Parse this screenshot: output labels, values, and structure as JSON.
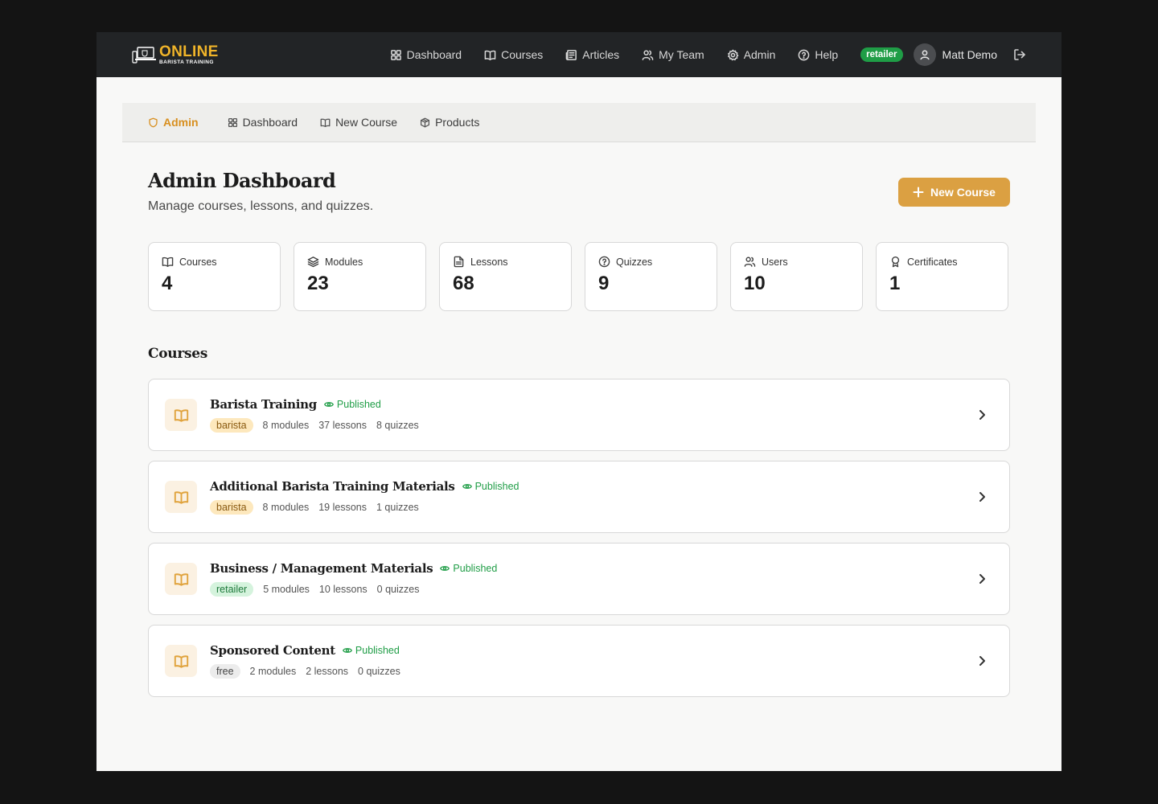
{
  "brand": {
    "main": "ONLINE",
    "sub": "BARISTA TRAINING"
  },
  "topnav": {
    "items": [
      {
        "label": "Dashboard",
        "icon": "grid-icon"
      },
      {
        "label": "Courses",
        "icon": "book-icon"
      },
      {
        "label": "Articles",
        "icon": "newspaper-icon"
      },
      {
        "label": "My Team",
        "icon": "users-icon"
      },
      {
        "label": "Admin",
        "icon": "gear-icon"
      },
      {
        "label": "Help",
        "icon": "help-circle-icon"
      }
    ],
    "role_badge": "retailer",
    "user_name": "Matt Demo"
  },
  "subnav": {
    "items": [
      {
        "label": "Admin",
        "icon": "shield-icon",
        "active": true
      },
      {
        "label": "Dashboard",
        "icon": "grid-icon"
      },
      {
        "label": "New Course",
        "icon": "book-icon"
      },
      {
        "label": "Products",
        "icon": "box-icon"
      }
    ]
  },
  "page": {
    "title": "Admin Dashboard",
    "subtitle": "Manage courses, lessons, and quizzes.",
    "new_course_label": "New Course"
  },
  "stats": [
    {
      "label": "Courses",
      "value": "4",
      "icon": "book-icon"
    },
    {
      "label": "Modules",
      "value": "23",
      "icon": "layers-icon"
    },
    {
      "label": "Lessons",
      "value": "68",
      "icon": "file-text-icon"
    },
    {
      "label": "Quizzes",
      "value": "9",
      "icon": "help-circle-icon"
    },
    {
      "label": "Users",
      "value": "10",
      "icon": "users-icon"
    },
    {
      "label": "Certificates",
      "value": "1",
      "icon": "award-icon"
    }
  ],
  "courses_section": {
    "title": "Courses",
    "items": [
      {
        "title": "Barista Training",
        "status": "Published",
        "tag": "barista",
        "modules": "8 modules",
        "lessons": "37 lessons",
        "quizzes": "8 quizzes"
      },
      {
        "title": "Additional Barista Training Materials",
        "status": "Published",
        "tag": "barista",
        "modules": "8 modules",
        "lessons": "19 lessons",
        "quizzes": "1 quizzes"
      },
      {
        "title": "Business / Management Materials",
        "status": "Published",
        "tag": "retailer",
        "modules": "5 modules",
        "lessons": "10 lessons",
        "quizzes": "0 quizzes"
      },
      {
        "title": "Sponsored Content",
        "status": "Published",
        "tag": "free",
        "modules": "2 modules",
        "lessons": "2 lessons",
        "quizzes": "0 quizzes"
      }
    ]
  },
  "colors": {
    "accent": "#dba042",
    "published": "#1f9d46",
    "topbar": "#222426"
  }
}
